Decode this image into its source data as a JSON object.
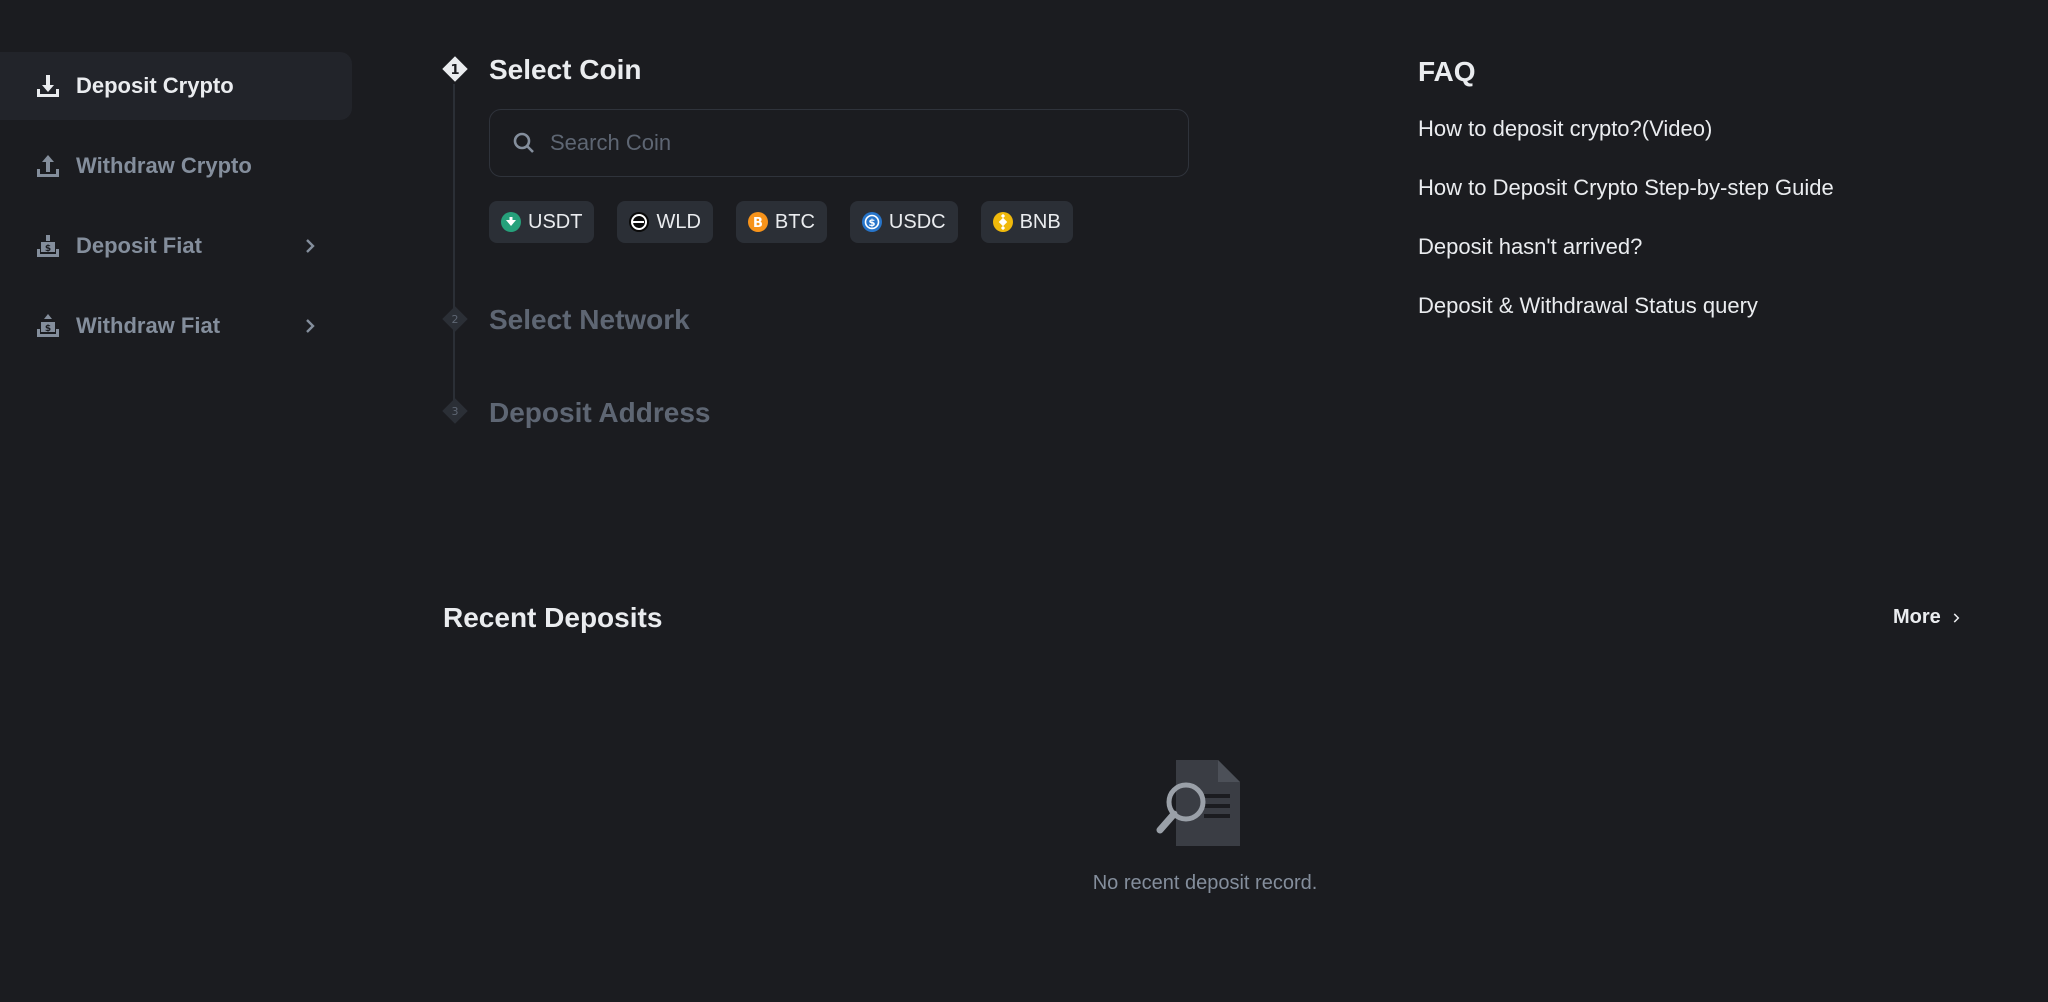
{
  "sidebar": {
    "items": [
      {
        "label": "Deposit Crypto",
        "icon": "download-icon",
        "active": true
      },
      {
        "label": "Withdraw Crypto",
        "icon": "upload-icon",
        "active": false
      },
      {
        "label": "Deposit Fiat",
        "icon": "deposit-fiat-icon",
        "active": false,
        "has_chevron": true
      },
      {
        "label": "Withdraw Fiat",
        "icon": "withdraw-fiat-icon",
        "active": false,
        "has_chevron": true
      }
    ]
  },
  "steps": [
    {
      "number": "1",
      "title": "Select Coin",
      "active": true
    },
    {
      "number": "2",
      "title": "Select Network",
      "active": false
    },
    {
      "number": "3",
      "title": "Deposit Address",
      "active": false
    }
  ],
  "search": {
    "placeholder": "Search Coin",
    "value": ""
  },
  "coins": [
    {
      "symbol": "USDT",
      "color": "#26a17b"
    },
    {
      "symbol": "WLD",
      "color": "#111111"
    },
    {
      "symbol": "BTC",
      "color": "#f7931a"
    },
    {
      "symbol": "USDC",
      "color": "#2775ca"
    },
    {
      "symbol": "BNB",
      "color": "#f0b90b"
    }
  ],
  "faq": {
    "title": "FAQ",
    "links": [
      "How to deposit crypto?(Video)",
      "How to Deposit Crypto Step-by-step Guide",
      "Deposit hasn't arrived?",
      "Deposit & Withdrawal Status query"
    ]
  },
  "recent": {
    "title": "Recent Deposits",
    "more_label": "More",
    "empty_text": "No recent deposit record."
  },
  "colors": {
    "background": "#1b1c20",
    "sidebar_active": "#22242a",
    "text_primary": "#eaecef",
    "text_secondary": "#848e9c",
    "text_disabled": "#5e6673",
    "chip_bg": "#2b2f36"
  }
}
